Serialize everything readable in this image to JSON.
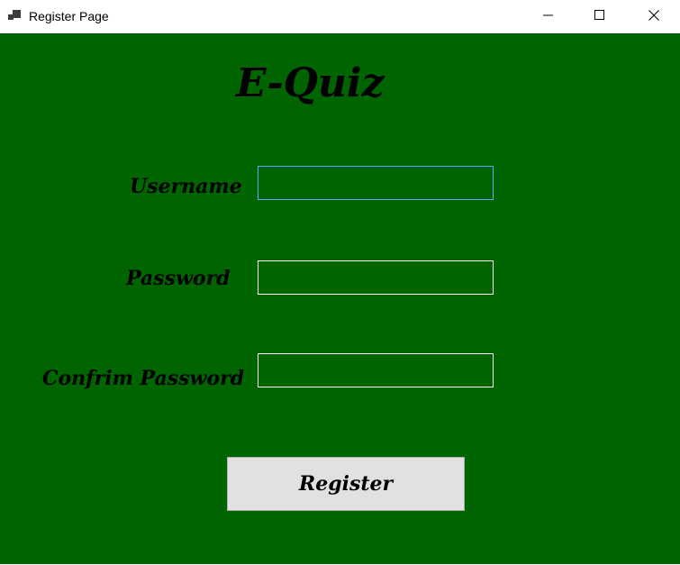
{
  "window": {
    "title": "Register Page",
    "app_icon": "forms-app-icon",
    "controls": {
      "minimize_icon": "minimize-icon",
      "maximize_icon": "maximize-icon",
      "close_icon": "close-icon"
    }
  },
  "form": {
    "brand": "E-Quiz",
    "background_color": "#006400",
    "fields": {
      "username_label": "Username",
      "username_value": "",
      "password_label": "Password",
      "password_value": "",
      "confirm_label": "Confrim Password",
      "confirm_value": ""
    },
    "register_label": "Register"
  }
}
